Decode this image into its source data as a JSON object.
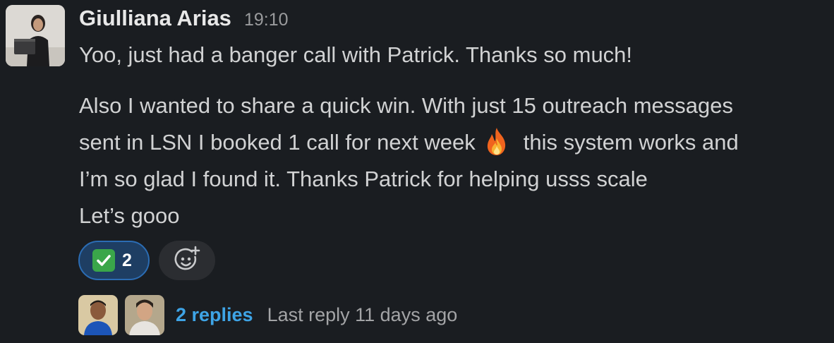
{
  "message": {
    "author": "Giulliana Arias",
    "time": "19:10",
    "line1": "Yoo, just had a banger call with Patrick. Thanks so much!",
    "para2_line1": "Also I wanted to share a quick win. With just 15 outreach messages",
    "para2_line2_a": "sent in LSN I booked 1 call for next week",
    "para2_line2_b": "this system works and",
    "para2_line3": "I’m so glad I found it. Thanks Patrick for helping usss scale",
    "para2_line4": "Let’s gooo",
    "inline_emoji": "fire-emoji"
  },
  "reactions": [
    {
      "emoji": "white-check-mark-emoji",
      "count": "2",
      "active": true
    }
  ],
  "add_reaction_icon": "add-reaction-icon",
  "thread": {
    "replies_label": "2 replies",
    "last_reply": "Last reply 11 days ago"
  },
  "colors": {
    "background": "#1a1d21",
    "link": "#3ea4e6",
    "reaction_active_bg": "#1e3e63",
    "reaction_active_border": "#2b6cb3"
  }
}
